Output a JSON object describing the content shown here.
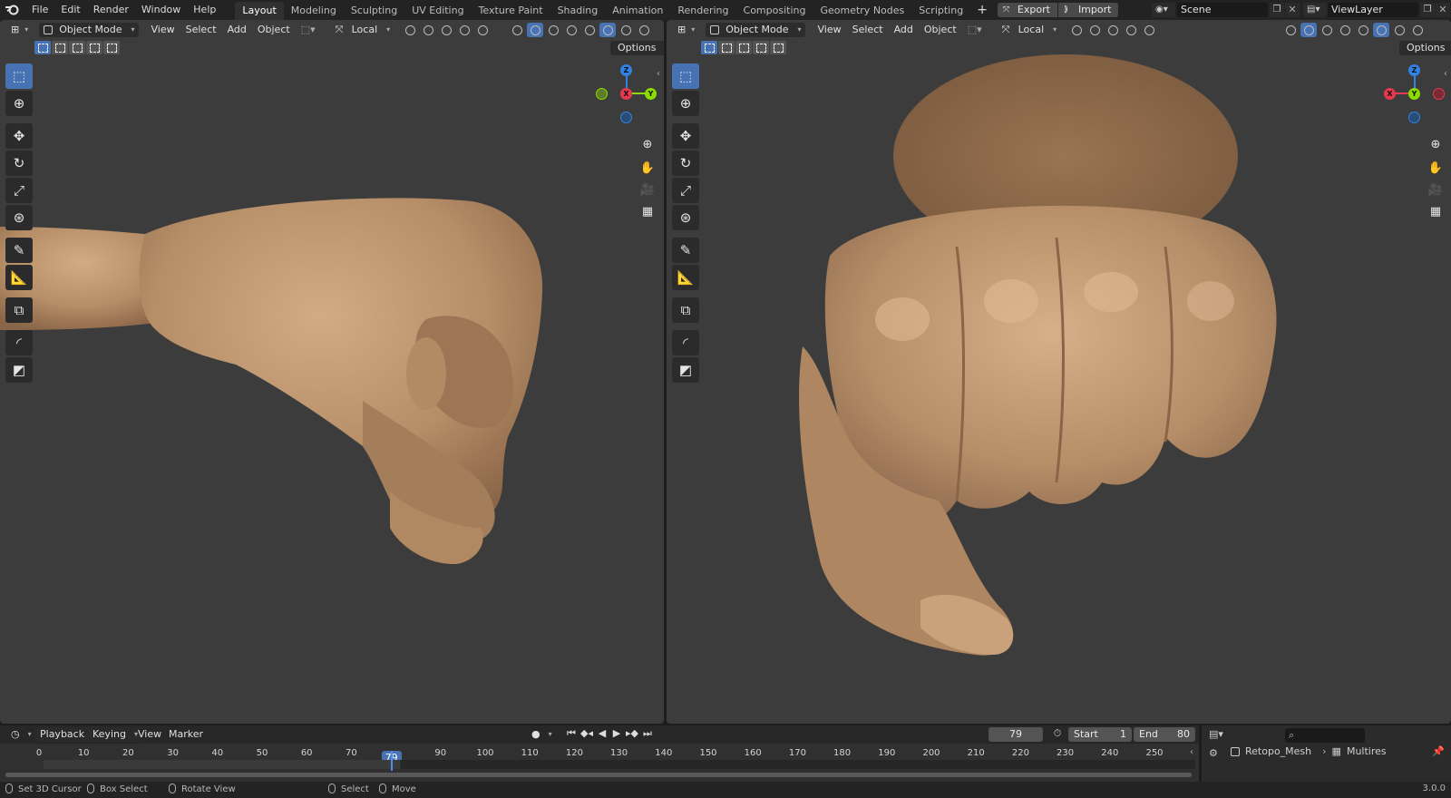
{
  "app": {
    "logo": "blender-logo-icon",
    "version": "3.0.0"
  },
  "menu": {
    "file": "File",
    "edit": "Edit",
    "render": "Render",
    "window": "Window",
    "help": "Help"
  },
  "workspaces": [
    {
      "label": "Layout",
      "active": true
    },
    {
      "label": "Modeling"
    },
    {
      "label": "Sculpting"
    },
    {
      "label": "UV Editing"
    },
    {
      "label": "Texture Paint"
    },
    {
      "label": "Shading"
    },
    {
      "label": "Animation"
    },
    {
      "label": "Rendering"
    },
    {
      "label": "Compositing"
    },
    {
      "label": "Geometry Nodes"
    },
    {
      "label": "Scripting"
    }
  ],
  "addon": {
    "export": "Export",
    "import": "Import"
  },
  "scene": {
    "value": "Scene"
  },
  "view_layer": {
    "value": "ViewLayer"
  },
  "viewport_header": {
    "mode": "Object Mode",
    "view": "View",
    "select": "Select",
    "add": "Add",
    "object": "Object",
    "orientation": "Local",
    "options": "Options"
  },
  "gizmo": {
    "x": "X",
    "y": "Y",
    "z": "Z"
  },
  "timeline": {
    "playback": "Playback",
    "keying": "Keying",
    "view": "View",
    "marker": "Marker",
    "current_frame": "79",
    "start_label": "Start",
    "start_value": "1",
    "end_label": "End",
    "end_value": "80",
    "ticks": [
      "0",
      "10",
      "20",
      "30",
      "40",
      "50",
      "60",
      "70",
      "79",
      "90",
      "100",
      "110",
      "120",
      "130",
      "140",
      "150",
      "160",
      "170",
      "180",
      "190",
      "200",
      "210",
      "220",
      "230",
      "240",
      "250"
    ]
  },
  "outliner": {
    "object": "Retopo_Mesh",
    "modifier": "Multires"
  },
  "statusbar": {
    "set_cursor": "Set 3D Cursor",
    "box_select": "Box Select",
    "rotate_view": "Rotate View",
    "select": "Select",
    "move": "Move"
  },
  "colors": {
    "accent": "#4772b3",
    "viewport_bg": "#3c3c3c",
    "skin": "#b48c66",
    "axis_x": "#e8384f",
    "axis_y": "#8bdc00",
    "axis_z": "#2f83e3"
  }
}
